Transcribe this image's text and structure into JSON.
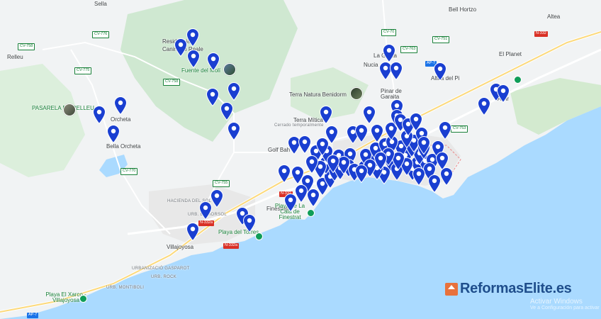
{
  "map": {
    "places": [
      {
        "name": "Sella",
        "cls": "town"
      },
      {
        "name": "Bell Hortzo",
        "cls": "town"
      },
      {
        "name": "Altea",
        "cls": "town"
      },
      {
        "name": "Relleu",
        "cls": "town"
      },
      {
        "name": "Residencia",
        "cls": "town"
      },
      {
        "name": "Canina El Reale",
        "cls": "town"
      },
      {
        "name": "Fuente del Molí",
        "cls": "green"
      },
      {
        "name": "El Planet",
        "cls": "town"
      },
      {
        "name": "La Garita",
        "cls": "town"
      },
      {
        "name": "Nucia",
        "cls": "town"
      },
      {
        "name": "Altea del Pi",
        "cls": "town"
      },
      {
        "name": "PASARELA DE RELLEU",
        "cls": "green"
      },
      {
        "name": "Orcheta",
        "cls": "town"
      },
      {
        "name": "Terra Natura Benidorm",
        "cls": "poi"
      },
      {
        "name": "Pinar de Garaita",
        "cls": "town"
      },
      {
        "name": "Terra Mítica",
        "cls": "poi"
      },
      {
        "name": "Cerrado temporalmente",
        "cls": "small"
      },
      {
        "name": "Golf Bah",
        "cls": "town"
      },
      {
        "name": "Bella Orcheta",
        "cls": "town"
      },
      {
        "name": "Finestrat",
        "cls": "town"
      },
      {
        "name": "HACIENDA DEL SOL",
        "cls": "small"
      },
      {
        "name": "URB. EL MORSOL",
        "cls": "small"
      },
      {
        "name": "Playa de La Cala de Finestrat",
        "cls": "green"
      },
      {
        "name": "Playa del Torres",
        "cls": "green"
      },
      {
        "name": "Villajoyosa",
        "cls": "town"
      },
      {
        "name": "URBANIZACIÓ GASPAROT",
        "cls": "small"
      },
      {
        "name": "URB. ROCK",
        "cls": "small"
      },
      {
        "name": "URB. MONTIBOLI",
        "cls": "small"
      },
      {
        "name": "Playa El Xarco - Villajoyosa",
        "cls": "green"
      },
      {
        "name": "Albir",
        "cls": "town"
      }
    ],
    "roads": [
      {
        "code": "CV-776",
        "style": "green"
      },
      {
        "code": "CV-775",
        "style": "green"
      },
      {
        "code": "CV-70",
        "style": "green"
      },
      {
        "code": "CV-763",
        "style": "green"
      },
      {
        "code": "CV-751",
        "style": "green"
      },
      {
        "code": "N-332",
        "style": "red"
      },
      {
        "code": "AP-7",
        "style": "blue"
      },
      {
        "code": "CV-758",
        "style": "green"
      },
      {
        "code": "CV-770",
        "style": "green"
      },
      {
        "code": "CV-755",
        "style": "green"
      },
      {
        "code": "N-332",
        "style": "red"
      },
      {
        "code": "N-332a",
        "style": "red"
      },
      {
        "code": "N-332a",
        "style": "red"
      },
      {
        "code": "CV-753",
        "style": "green"
      },
      {
        "code": "AP-7",
        "style": "blue"
      },
      {
        "code": "CV-758",
        "style": "green"
      }
    ],
    "pin_count": 95,
    "pin_color": "#1a3fd1",
    "sea_color": "#aadaff",
    "land_color": "#f1f3f4",
    "park_color": "#cfe8d1"
  },
  "brand": {
    "name": "ReformasElite.es",
    "logo_icon": "house-logo-icon",
    "color": "#1f4e8c"
  },
  "windows_notice": {
    "title": "Activar Windows",
    "subtitle": "Ve a Configuración para activar"
  }
}
